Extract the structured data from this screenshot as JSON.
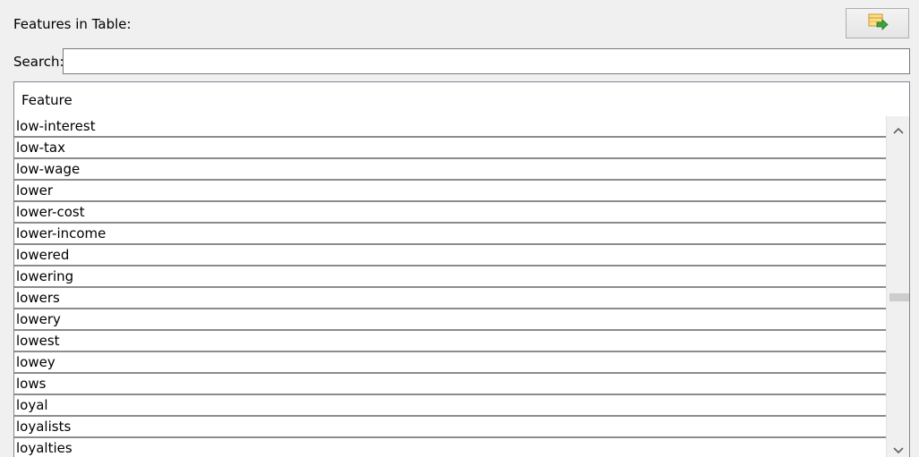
{
  "header": {
    "title": "Features in Table:",
    "export_button_icon": "export-table-icon"
  },
  "search": {
    "label": "Search:",
    "value": "",
    "placeholder": ""
  },
  "table": {
    "column_header": "Feature",
    "rows": [
      "low-interest",
      "low-tax",
      "low-wage",
      "lower",
      "lower-cost",
      "lower-income",
      "lowered",
      "lowering",
      "lowers",
      "lowery",
      "lowest",
      "lowey",
      "lows",
      "loyal",
      "loyalists",
      "loyalties"
    ]
  },
  "scrollbar": {
    "up_icon": "chevron-up-icon",
    "down_icon": "chevron-down-icon",
    "position": 0.53
  },
  "colors": {
    "background": "#f0f0f0",
    "row_divider": "#8c8c8c",
    "icon_yellow": "#f5c242",
    "icon_green": "#3aa63a"
  }
}
